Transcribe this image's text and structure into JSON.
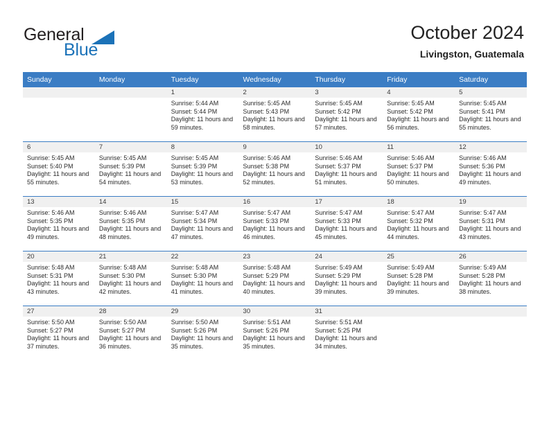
{
  "brand": {
    "line1": "General",
    "line2": "Blue",
    "triangle_color": "#1b72b8"
  },
  "header": {
    "title": "October 2024",
    "location": "Livingston, Guatemala"
  },
  "theme": {
    "header_row_bg": "#3b7dc4",
    "header_row_text": "#ffffff",
    "daynum_band_bg": "#f0f0f0",
    "grid_line": "#3b7dc4",
    "body_text": "#2b2b2b"
  },
  "weekday_headers": [
    "Sunday",
    "Monday",
    "Tuesday",
    "Wednesday",
    "Thursday",
    "Friday",
    "Saturday"
  ],
  "weeks": [
    [
      {
        "day": "",
        "empty": true,
        "sunrise": "",
        "sunset": "",
        "daylight": ""
      },
      {
        "day": "",
        "empty": true,
        "sunrise": "",
        "sunset": "",
        "daylight": ""
      },
      {
        "day": "1",
        "empty": false,
        "sunrise": "Sunrise: 5:44 AM",
        "sunset": "Sunset: 5:44 PM",
        "daylight": "Daylight: 11 hours and 59 minutes."
      },
      {
        "day": "2",
        "empty": false,
        "sunrise": "Sunrise: 5:45 AM",
        "sunset": "Sunset: 5:43 PM",
        "daylight": "Daylight: 11 hours and 58 minutes."
      },
      {
        "day": "3",
        "empty": false,
        "sunrise": "Sunrise: 5:45 AM",
        "sunset": "Sunset: 5:42 PM",
        "daylight": "Daylight: 11 hours and 57 minutes."
      },
      {
        "day": "4",
        "empty": false,
        "sunrise": "Sunrise: 5:45 AM",
        "sunset": "Sunset: 5:42 PM",
        "daylight": "Daylight: 11 hours and 56 minutes."
      },
      {
        "day": "5",
        "empty": false,
        "sunrise": "Sunrise: 5:45 AM",
        "sunset": "Sunset: 5:41 PM",
        "daylight": "Daylight: 11 hours and 55 minutes."
      }
    ],
    [
      {
        "day": "6",
        "empty": false,
        "sunrise": "Sunrise: 5:45 AM",
        "sunset": "Sunset: 5:40 PM",
        "daylight": "Daylight: 11 hours and 55 minutes."
      },
      {
        "day": "7",
        "empty": false,
        "sunrise": "Sunrise: 5:45 AM",
        "sunset": "Sunset: 5:39 PM",
        "daylight": "Daylight: 11 hours and 54 minutes."
      },
      {
        "day": "8",
        "empty": false,
        "sunrise": "Sunrise: 5:45 AM",
        "sunset": "Sunset: 5:39 PM",
        "daylight": "Daylight: 11 hours and 53 minutes."
      },
      {
        "day": "9",
        "empty": false,
        "sunrise": "Sunrise: 5:46 AM",
        "sunset": "Sunset: 5:38 PM",
        "daylight": "Daylight: 11 hours and 52 minutes."
      },
      {
        "day": "10",
        "empty": false,
        "sunrise": "Sunrise: 5:46 AM",
        "sunset": "Sunset: 5:37 PM",
        "daylight": "Daylight: 11 hours and 51 minutes."
      },
      {
        "day": "11",
        "empty": false,
        "sunrise": "Sunrise: 5:46 AM",
        "sunset": "Sunset: 5:37 PM",
        "daylight": "Daylight: 11 hours and 50 minutes."
      },
      {
        "day": "12",
        "empty": false,
        "sunrise": "Sunrise: 5:46 AM",
        "sunset": "Sunset: 5:36 PM",
        "daylight": "Daylight: 11 hours and 49 minutes."
      }
    ],
    [
      {
        "day": "13",
        "empty": false,
        "sunrise": "Sunrise: 5:46 AM",
        "sunset": "Sunset: 5:35 PM",
        "daylight": "Daylight: 11 hours and 49 minutes."
      },
      {
        "day": "14",
        "empty": false,
        "sunrise": "Sunrise: 5:46 AM",
        "sunset": "Sunset: 5:35 PM",
        "daylight": "Daylight: 11 hours and 48 minutes."
      },
      {
        "day": "15",
        "empty": false,
        "sunrise": "Sunrise: 5:47 AM",
        "sunset": "Sunset: 5:34 PM",
        "daylight": "Daylight: 11 hours and 47 minutes."
      },
      {
        "day": "16",
        "empty": false,
        "sunrise": "Sunrise: 5:47 AM",
        "sunset": "Sunset: 5:33 PM",
        "daylight": "Daylight: 11 hours and 46 minutes."
      },
      {
        "day": "17",
        "empty": false,
        "sunrise": "Sunrise: 5:47 AM",
        "sunset": "Sunset: 5:33 PM",
        "daylight": "Daylight: 11 hours and 45 minutes."
      },
      {
        "day": "18",
        "empty": false,
        "sunrise": "Sunrise: 5:47 AM",
        "sunset": "Sunset: 5:32 PM",
        "daylight": "Daylight: 11 hours and 44 minutes."
      },
      {
        "day": "19",
        "empty": false,
        "sunrise": "Sunrise: 5:47 AM",
        "sunset": "Sunset: 5:31 PM",
        "daylight": "Daylight: 11 hours and 43 minutes."
      }
    ],
    [
      {
        "day": "20",
        "empty": false,
        "sunrise": "Sunrise: 5:48 AM",
        "sunset": "Sunset: 5:31 PM",
        "daylight": "Daylight: 11 hours and 43 minutes."
      },
      {
        "day": "21",
        "empty": false,
        "sunrise": "Sunrise: 5:48 AM",
        "sunset": "Sunset: 5:30 PM",
        "daylight": "Daylight: 11 hours and 42 minutes."
      },
      {
        "day": "22",
        "empty": false,
        "sunrise": "Sunrise: 5:48 AM",
        "sunset": "Sunset: 5:30 PM",
        "daylight": "Daylight: 11 hours and 41 minutes."
      },
      {
        "day": "23",
        "empty": false,
        "sunrise": "Sunrise: 5:48 AM",
        "sunset": "Sunset: 5:29 PM",
        "daylight": "Daylight: 11 hours and 40 minutes."
      },
      {
        "day": "24",
        "empty": false,
        "sunrise": "Sunrise: 5:49 AM",
        "sunset": "Sunset: 5:29 PM",
        "daylight": "Daylight: 11 hours and 39 minutes."
      },
      {
        "day": "25",
        "empty": false,
        "sunrise": "Sunrise: 5:49 AM",
        "sunset": "Sunset: 5:28 PM",
        "daylight": "Daylight: 11 hours and 39 minutes."
      },
      {
        "day": "26",
        "empty": false,
        "sunrise": "Sunrise: 5:49 AM",
        "sunset": "Sunset: 5:28 PM",
        "daylight": "Daylight: 11 hours and 38 minutes."
      }
    ],
    [
      {
        "day": "27",
        "empty": false,
        "sunrise": "Sunrise: 5:50 AM",
        "sunset": "Sunset: 5:27 PM",
        "daylight": "Daylight: 11 hours and 37 minutes."
      },
      {
        "day": "28",
        "empty": false,
        "sunrise": "Sunrise: 5:50 AM",
        "sunset": "Sunset: 5:27 PM",
        "daylight": "Daylight: 11 hours and 36 minutes."
      },
      {
        "day": "29",
        "empty": false,
        "sunrise": "Sunrise: 5:50 AM",
        "sunset": "Sunset: 5:26 PM",
        "daylight": "Daylight: 11 hours and 35 minutes."
      },
      {
        "day": "30",
        "empty": false,
        "sunrise": "Sunrise: 5:51 AM",
        "sunset": "Sunset: 5:26 PM",
        "daylight": "Daylight: 11 hours and 35 minutes."
      },
      {
        "day": "31",
        "empty": false,
        "sunrise": "Sunrise: 5:51 AM",
        "sunset": "Sunset: 5:25 PM",
        "daylight": "Daylight: 11 hours and 34 minutes."
      },
      {
        "day": "",
        "empty": true,
        "sunrise": "",
        "sunset": "",
        "daylight": ""
      },
      {
        "day": "",
        "empty": true,
        "sunrise": "",
        "sunset": "",
        "daylight": ""
      }
    ]
  ]
}
